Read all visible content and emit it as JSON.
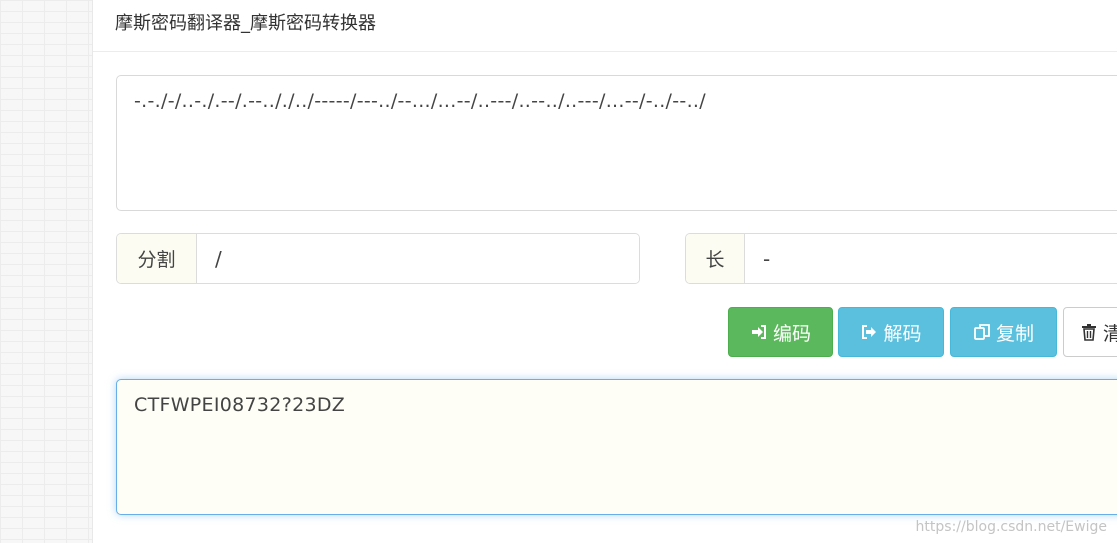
{
  "header": {
    "title": "摩斯密码翻译器_摩斯密码转换器"
  },
  "input": {
    "value": "-.-./-/..-./.--/.--.././../-----/---../--.../...--/..---/..--../..---/...--/-../--../"
  },
  "options": {
    "split_label": "分割",
    "split_value": "/",
    "long_label": "长",
    "long_value": "-"
  },
  "buttons": {
    "encode_label": "编码",
    "decode_label": "解码",
    "copy_label": "复制",
    "clear_label": "清"
  },
  "output": {
    "value": "CTFWPEI08732?23DZ"
  },
  "watermark": "https://blog.csdn.net/Ewige",
  "colors": {
    "encode": "#5cb85c",
    "decode": "#5bc0de",
    "copy": "#5bc0de",
    "focus_border": "#66afe9"
  },
  "icons": {
    "encode": "sign-in-icon",
    "decode": "sign-out-icon",
    "copy": "copy-icon",
    "clear": "trash-icon"
  }
}
